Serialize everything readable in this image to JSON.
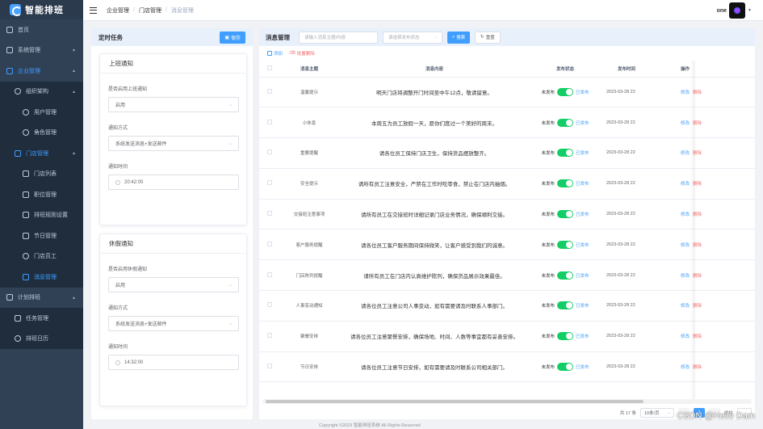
{
  "app": {
    "logo_text": "智能排班"
  },
  "header": {
    "breadcrumb": [
      "企业管理",
      "门店管理",
      "消息管理"
    ],
    "username": "one"
  },
  "sidebar": {
    "items": [
      {
        "label": "首页",
        "level": 0
      },
      {
        "label": "系统管理",
        "level": 0
      },
      {
        "label": "企业管理",
        "level": 0
      },
      {
        "label": "组织架构",
        "level": 1
      },
      {
        "label": "用户管理",
        "level": 2
      },
      {
        "label": "角色管理",
        "level": 2
      },
      {
        "label": "门店管理",
        "level": 1
      },
      {
        "label": "门店列表",
        "level": 2
      },
      {
        "label": "职位管理",
        "level": 2
      },
      {
        "label": "排班规则设置",
        "level": 2
      },
      {
        "label": "节日管理",
        "level": 2
      },
      {
        "label": "门店员工",
        "level": 2
      },
      {
        "label": "消息管理",
        "level": 2
      },
      {
        "label": "计划排班",
        "level": 0
      },
      {
        "label": "任务管理",
        "level": 1
      },
      {
        "label": "排班日历",
        "level": 1
      }
    ]
  },
  "scheduled": {
    "title": "定时任务",
    "save_label": "保存",
    "work": {
      "title": "上班通知",
      "enable_label": "是否启用上班通知",
      "enable_value": "启用",
      "method_label": "通知方式",
      "method_value": "系统发送消息+发送邮件",
      "time_label": "通知时间",
      "time_value": "20:42:00"
    },
    "leave": {
      "title": "休假通知",
      "enable_label": "是否启用休假通知",
      "enable_value": "启用",
      "method_label": "通知方式",
      "method_value": "系统发送消息+发送邮件",
      "time_label": "通知时间",
      "time_value": "14:32:00"
    }
  },
  "messages": {
    "title": "消息管理",
    "search_placeholder": "请输入消息主题/内容",
    "status_placeholder": "请选择发布状态",
    "search_label": "搜索",
    "reset_label": "重置",
    "add_label": "添加",
    "batch_delete_label": "批量删除",
    "columns": [
      "消息主题",
      "消息内容",
      "发布状态",
      "发布时间",
      "操作"
    ],
    "status_off": "未发布",
    "status_on": "已发布",
    "edit_label": "修改",
    "delete_label": "删除",
    "rows": [
      {
        "topic": "温馨提示",
        "content": "明天门店将调整开门时间至中午12点，敬请留意。",
        "time": "2023-03-28 22"
      },
      {
        "topic": "小休息",
        "content": "本周五为员工放假一天，愿你们度过一个美好的周末。",
        "time": "2023-03-28 22"
      },
      {
        "topic": "重要提醒",
        "content": "请各位员工保持门店卫生，保持货品摆放整齐。",
        "time": "2023-03-28 22"
      },
      {
        "topic": "安全提示",
        "content": "请所有员工注意安全，严禁在工作时吃零食，禁止在门店内抽烟。",
        "time": "2023-03-28 22"
      },
      {
        "topic": "交接班注意事项",
        "content": "请所有员工在交接班时详细记录门店业务情况，确保顺利交接。",
        "time": "2023-03-28 22"
      },
      {
        "topic": "客户服务提醒",
        "content": "请各位员工客户服务期间保持微笑，让客户感受到我们的诚意。",
        "time": "2023-03-28 22"
      },
      {
        "topic": "门店陈列提醒",
        "content": "请所有员工在门店内认真维护陈列，确保货品展示效果最佳。",
        "time": "2023-03-28 22"
      },
      {
        "topic": "人事变动通知",
        "content": "请各位员工注意公司人事变动，如有需要请及时联系人事部门。",
        "time": "2023-03-28 22"
      },
      {
        "topic": "聚餐安排",
        "content": "请各位员工注意聚餐安排，确保场地、时间、人数等事宜都有妥善安排。",
        "time": "2023-03-28 22"
      },
      {
        "topic": "节日安排",
        "content": "请各位员工注意节日安排，如有需要请及时联系公司相关部门。",
        "time": "2023-03-28 22"
      }
    ],
    "pagination": {
      "total": "共 17 条",
      "page_size": "10条/页",
      "current_page": "1",
      "goto_label": "前往"
    }
  },
  "footer": {
    "copyright": "Copyright ©2023 智能排班系统 All Rights Reserved"
  },
  "watermark": "CSDN @Hello Dam",
  "colors": {
    "primary": "#409eff",
    "sidebar_bg": "#304156",
    "danger": "#f56c6c",
    "switch_on": "#13ce66"
  }
}
